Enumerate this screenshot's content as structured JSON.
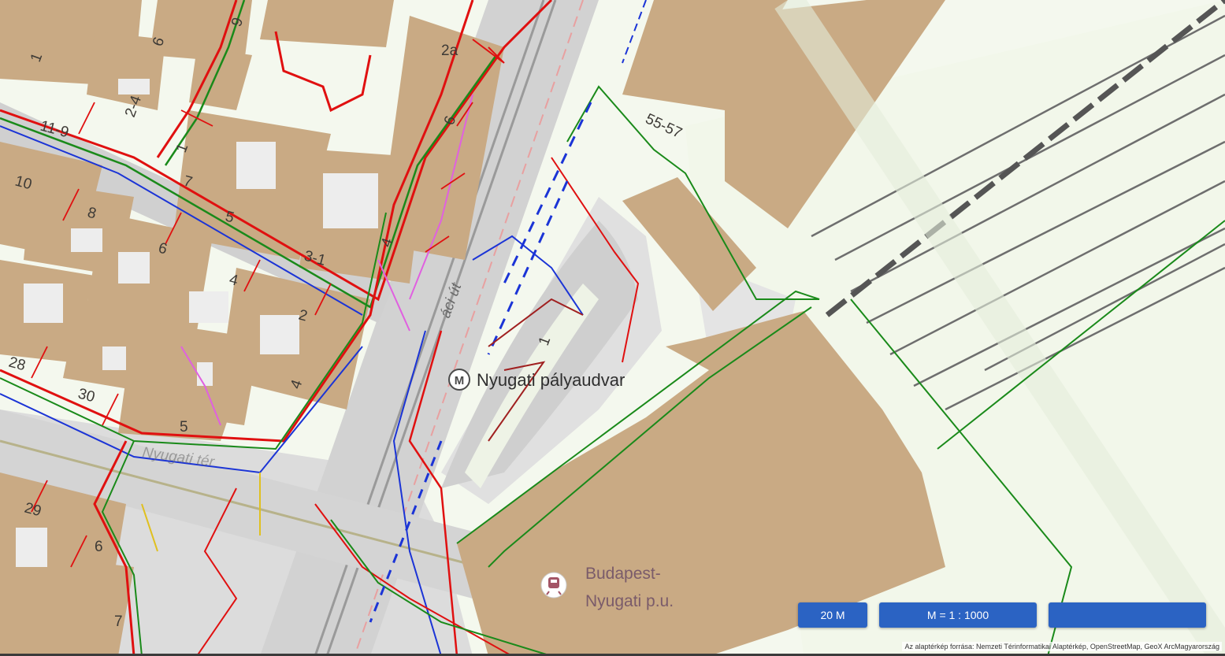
{
  "map": {
    "poi_station": "Nyugati pályaudvar",
    "poi_rail_line1": "Budapest-",
    "poi_rail_line2": "Nyugati p.u.",
    "street_vaci": "áci út",
    "street_nyugati_ter": "Nyugati tér",
    "house_numbers": [
      "1",
      "6",
      "9",
      "2a",
      "11-9",
      "2-4",
      "6",
      "55-57",
      "1",
      "10",
      "7",
      "8",
      "5",
      "3-1",
      "6",
      "4",
      "4",
      "2",
      "28",
      "30",
      "4",
      "5",
      "29",
      "6",
      "7",
      "1"
    ]
  },
  "controls": {
    "scale_label": "20 M",
    "ratio_label": "M = 1 : 1000",
    "blank_label": ""
  },
  "attribution": "Az alaptérkép forrása: Nemzeti Térinformatikai Alaptérkép, OpenStreetMap, GeoX ArcMagyarország",
  "colors": {
    "building": "#c9aa84",
    "road": "#d6d6d6",
    "button": "#2b63c3"
  }
}
